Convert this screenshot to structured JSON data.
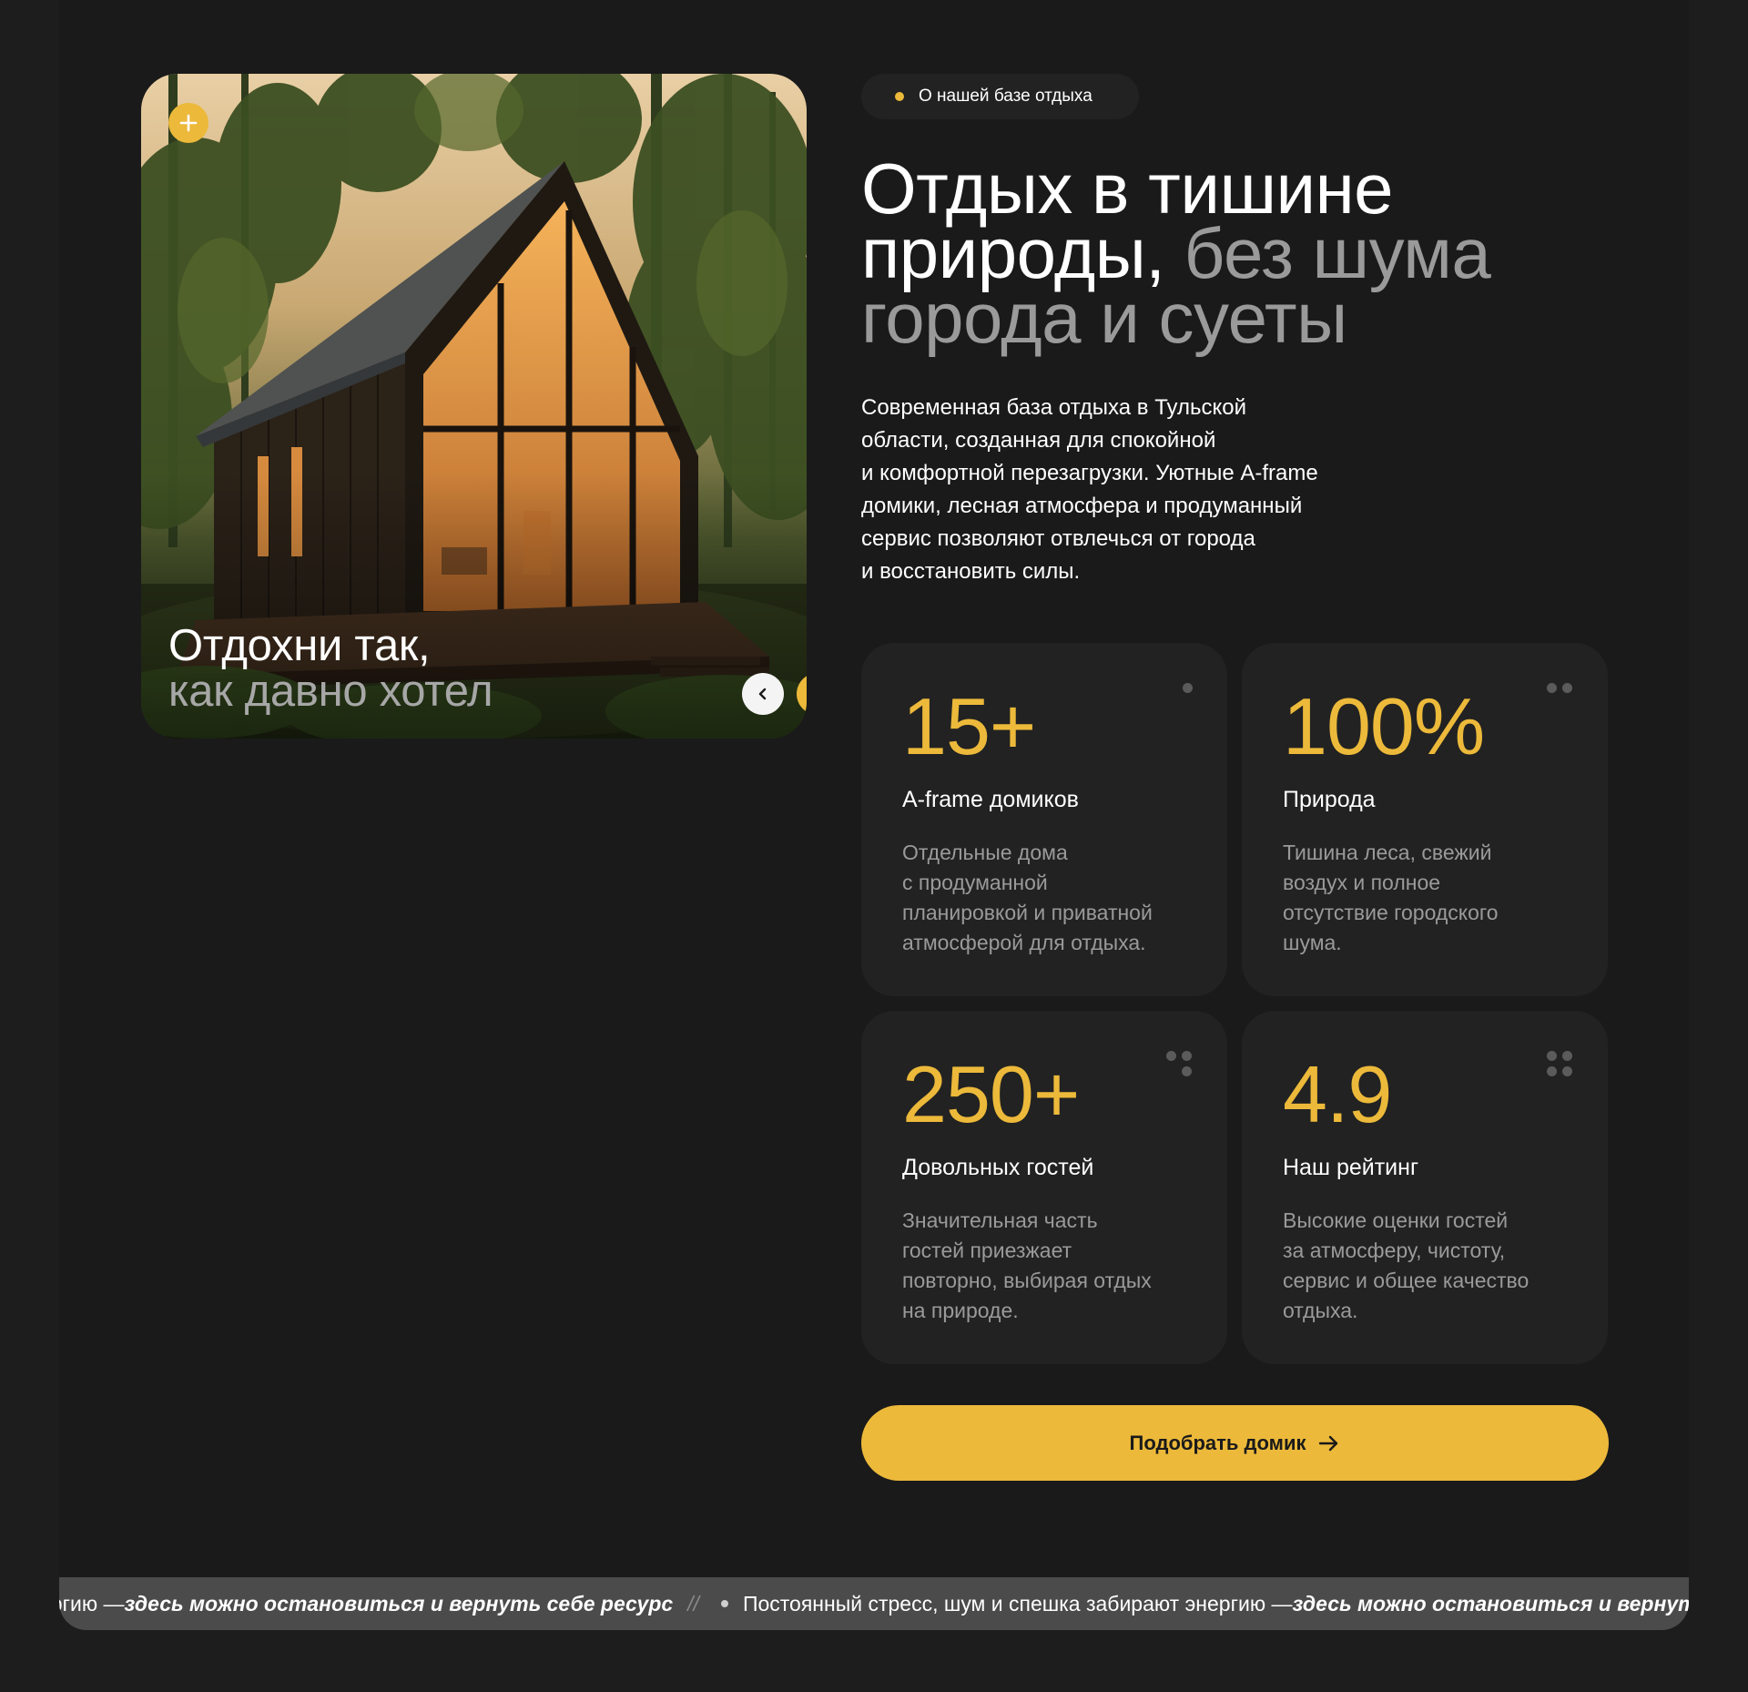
{
  "about_badge": {
    "label": "О нашей базе отдыха"
  },
  "headline": {
    "line1": "Отдых в тишине",
    "line2_white": "природы,",
    "line2_grey": " без шума",
    "line3_grey": "города и суеты"
  },
  "description": {
    "lines": [
      "Современная база отдыха в Тульской",
      "области, созданная для спокойной",
      "и комфортной перезагрузки. Уютные A-frame",
      "домики, лесная атмосфера и продуманный",
      "сервис позволяют отвлечься от города",
      "и восстановить силы."
    ]
  },
  "photo_card": {
    "caption_line1": "Отдохни так,",
    "caption_line2": "как давно хотел",
    "plus_icon": "plus-icon",
    "prev_icon": "chevron-left-icon",
    "next_icon": "chevron-right-icon"
  },
  "stats": [
    {
      "value": "15+",
      "title": "A-frame домиков",
      "text": [
        "Отдельные дома",
        "с продуманной",
        "планировкой и приватной",
        "атмосферой для отдыха."
      ],
      "dots": 1
    },
    {
      "value": "100%",
      "title": "Природа",
      "text": [
        "Тишина леса, свежий",
        "воздух и полное",
        "отсутствие городского",
        "шума."
      ],
      "dots": 2
    },
    {
      "value": "250+",
      "title": "Довольных гостей",
      "text": [
        "Значительная часть",
        "гостей приезжает",
        "повторно, выбирая отдых",
        "на природе."
      ],
      "dots": 3
    },
    {
      "value": "4.9",
      "title": "Наш рейтинг",
      "text": [
        "Высокие оценки гостей",
        "за атмосферу, чистоту,",
        "сервис и общее качество",
        "отдыха."
      ],
      "dots": 4
    }
  ],
  "cta": {
    "label": "Подобрать домик",
    "icon": "arrow-right-icon"
  },
  "ticker": {
    "partial_plain": "ергию — ",
    "partial_emph": "здесь можно остановиться и вернуть себе ресурс",
    "separator": "//",
    "plain": "Постоянный стресс, шум и спешка забирают энергию — ",
    "emph": "здесь можно остановиться и вернуть себе ресурс"
  },
  "colors": {
    "accent": "#ecb93a",
    "background": "#1a1a1a",
    "card": "#222222",
    "muted": "#9a9a9a"
  }
}
